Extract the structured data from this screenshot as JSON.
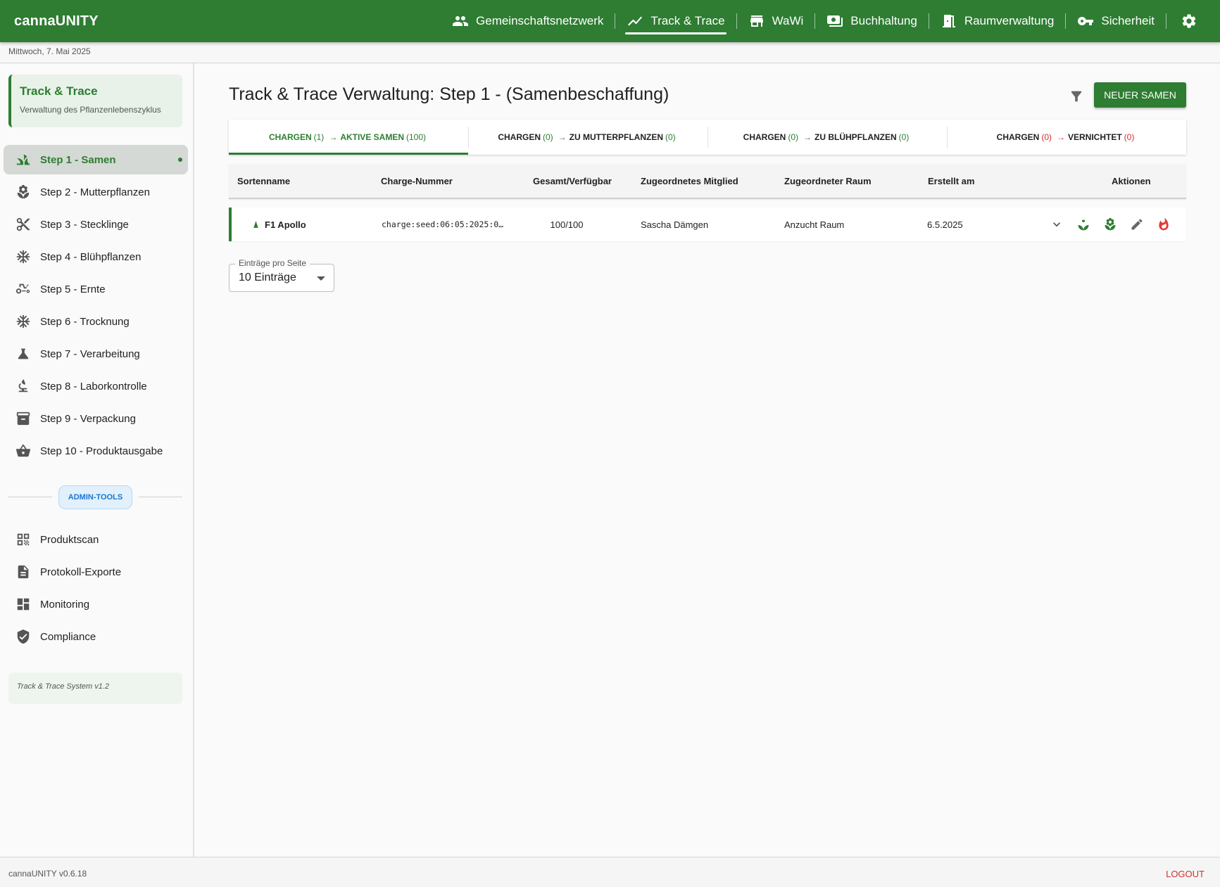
{
  "app": {
    "brand": "cannaUNITY"
  },
  "nav": {
    "items": [
      {
        "label": "Gemeinschaftsnetzwerk",
        "icon": "people-icon"
      },
      {
        "label": "Track & Trace",
        "icon": "trending-icon"
      },
      {
        "label": "WaWi",
        "icon": "store-icon"
      },
      {
        "label": "Buchhaltung",
        "icon": "cash-icon"
      },
      {
        "label": "Raumverwaltung",
        "icon": "door-icon"
      },
      {
        "label": "Sicherheit",
        "icon": "key-icon"
      }
    ],
    "active": "Track & Trace",
    "settings_icon": "gear-icon"
  },
  "date": "Mittwoch, 7. Mai 2025",
  "sidebar": {
    "title": "Track & Trace",
    "subtitle": "Verwaltung des Pflanzenlebenszyklus",
    "steps": [
      {
        "label": "Step 1 - Samen",
        "icon": "grass-icon"
      },
      {
        "label": "Step 2 - Mutterpflanzen",
        "icon": "plant-icon"
      },
      {
        "label": "Step 3 - Stecklinge",
        "icon": "scissors-icon"
      },
      {
        "label": "Step 4 - Blühpflanzen",
        "icon": "snowflake-icon"
      },
      {
        "label": "Step 5 - Ernte",
        "icon": "tractor-icon"
      },
      {
        "label": "Step 6 - Trocknung",
        "icon": "snowflake-icon"
      },
      {
        "label": "Step 7 - Verarbeitung",
        "icon": "flask-icon"
      },
      {
        "label": "Step 8 - Laborkontrolle",
        "icon": "microscope-icon"
      },
      {
        "label": "Step 9 - Verpackung",
        "icon": "archive-icon"
      },
      {
        "label": "Step 10 - Produktausgabe",
        "icon": "basket-icon"
      }
    ],
    "admin_label": "ADMIN-TOOLS",
    "tools": [
      {
        "label": "Produktscan",
        "icon": "qr-icon"
      },
      {
        "label": "Protokoll-Exporte",
        "icon": "document-icon"
      },
      {
        "label": "Monitoring",
        "icon": "dashboard-icon"
      },
      {
        "label": "Compliance",
        "icon": "shield-check-icon"
      }
    ],
    "footer": "Track & Trace System v1.2"
  },
  "main": {
    "title": "Track & Trace Verwaltung: Step 1 - (Samenbeschaffung)",
    "new_button": "NEUER SAMEN",
    "tabs": [
      {
        "a": "CHARGEN",
        "n1": "(1)",
        "b": "AKTIVE SAMEN",
        "n2": "(100)"
      },
      {
        "a": "CHARGEN",
        "n1": "(0)",
        "b": "ZU MUTTERPFLANZEN",
        "n2": "(0)"
      },
      {
        "a": "CHARGEN",
        "n1": "(0)",
        "b": "ZU BLÜHPFLANZEN",
        "n2": "(0)"
      },
      {
        "a": "CHARGEN",
        "n1": "(0)",
        "b": "VERNICHTET",
        "n2": "(0)"
      }
    ],
    "columns": [
      "Sortenname",
      "Charge-Nummer",
      "Gesamt/Verfügbar",
      "Zugeordnetes Mitglied",
      "Zugeordneter Raum",
      "Erstellt am",
      "Aktionen"
    ],
    "rows": [
      {
        "name": "F1 Apollo",
        "charge": "charge:seed:06:05:2025:0…",
        "count": "100/100",
        "member": "Sascha Dämgen",
        "room": "Anzucht Raum",
        "created": "6.5.2025"
      }
    ],
    "per_page_label": "Einträge pro Seite",
    "per_page_value": "10 Einträge"
  },
  "footer": {
    "version": "cannaUNITY v0.6.18",
    "logout": "LOGOUT"
  },
  "colors": {
    "primary": "#2e7d32",
    "danger": "#d32f2f",
    "admin": "#1976d2"
  }
}
